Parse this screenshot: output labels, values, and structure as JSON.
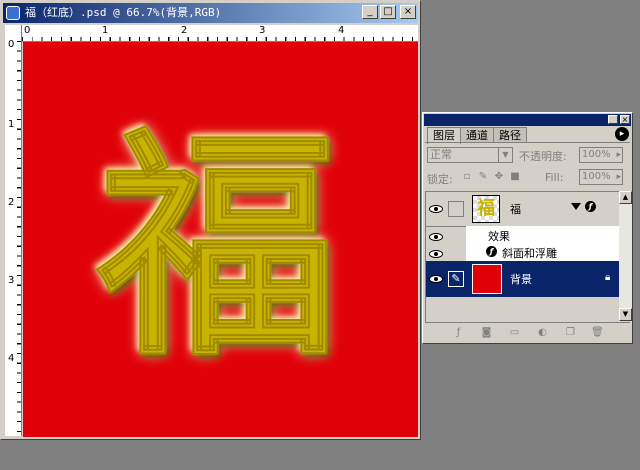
{
  "document": {
    "title": "福（红底）.psd @ 66.7%(背景,RGB)",
    "buttons": {
      "minimize": "_",
      "maximize": "□",
      "close": "×"
    },
    "ruler_top_numbers": [
      "0",
      "1",
      "2",
      "3",
      "4"
    ],
    "ruler_left_numbers": [
      "0",
      "1",
      "2",
      "3",
      "4"
    ],
    "canvas_character": "福",
    "canvas_color": "#e00008",
    "character_color": "#c8b400"
  },
  "layers_panel": {
    "tabs": [
      "图层",
      "通道",
      "路径"
    ],
    "active_tab": "图层",
    "blend_mode": "正常",
    "opacity_label": "不透明度:",
    "opacity_value": "100%",
    "lock_label": "锁定:",
    "fill_label": "Fill:",
    "fill_value": "100%",
    "layers": [
      {
        "name": "福",
        "visible": true,
        "has_effects": true
      },
      {
        "name": "背景",
        "visible": true,
        "selected": true,
        "locked": true
      }
    ],
    "effects_label": "效果",
    "effect_items": [
      "斜面和浮雕"
    ]
  }
}
